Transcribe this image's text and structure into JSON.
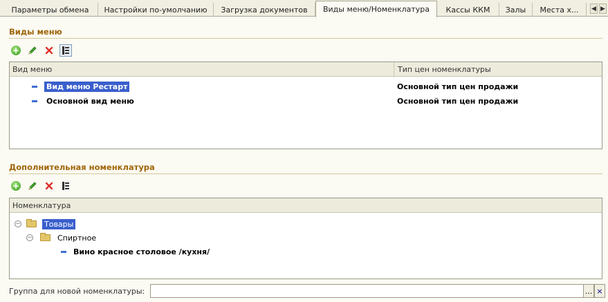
{
  "tabs": [
    {
      "label": "Параметры обмена"
    },
    {
      "label": "Настройки по-умолчанию"
    },
    {
      "label": "Загрузка документов"
    },
    {
      "label": "Виды меню/Номенклатура"
    },
    {
      "label": "Кассы ККМ"
    },
    {
      "label": "Залы"
    },
    {
      "label": "Места х..."
    }
  ],
  "active_tab": "Виды меню/Номенклатура",
  "menu_types": {
    "title": "Виды меню",
    "columns": [
      "Вид меню",
      "Тип цен номенклатуры"
    ],
    "rows": [
      {
        "name": "Вид меню Рестарт",
        "price_type": "Основной тип цен продажи",
        "selected": true
      },
      {
        "name": "Основной вид меню",
        "price_type": "Основной тип цен продажи",
        "selected": false
      }
    ]
  },
  "extra_nomenclature": {
    "title": "Дополнительная номенклатура",
    "column": "Номенклатура",
    "tree": [
      {
        "label": "Товары",
        "type": "folder",
        "selected": true
      },
      {
        "label": "Спиртное",
        "type": "folder"
      },
      {
        "label": "Вино красное столовое /кухня/",
        "type": "item"
      }
    ]
  },
  "new_group_field": {
    "label": "Группа для новой номенклатуры:",
    "value": "",
    "select_button": "...",
    "clear_button": "×"
  },
  "icons": {
    "add": "plus-circle-icon",
    "edit": "pencil-icon",
    "delete": "red-x-icon",
    "hierarchy": "hierarchy-icon"
  },
  "colors": {
    "section_title": "#a0660a",
    "selection": "#3a5fcd",
    "row_marker": "#3f6fd1"
  }
}
